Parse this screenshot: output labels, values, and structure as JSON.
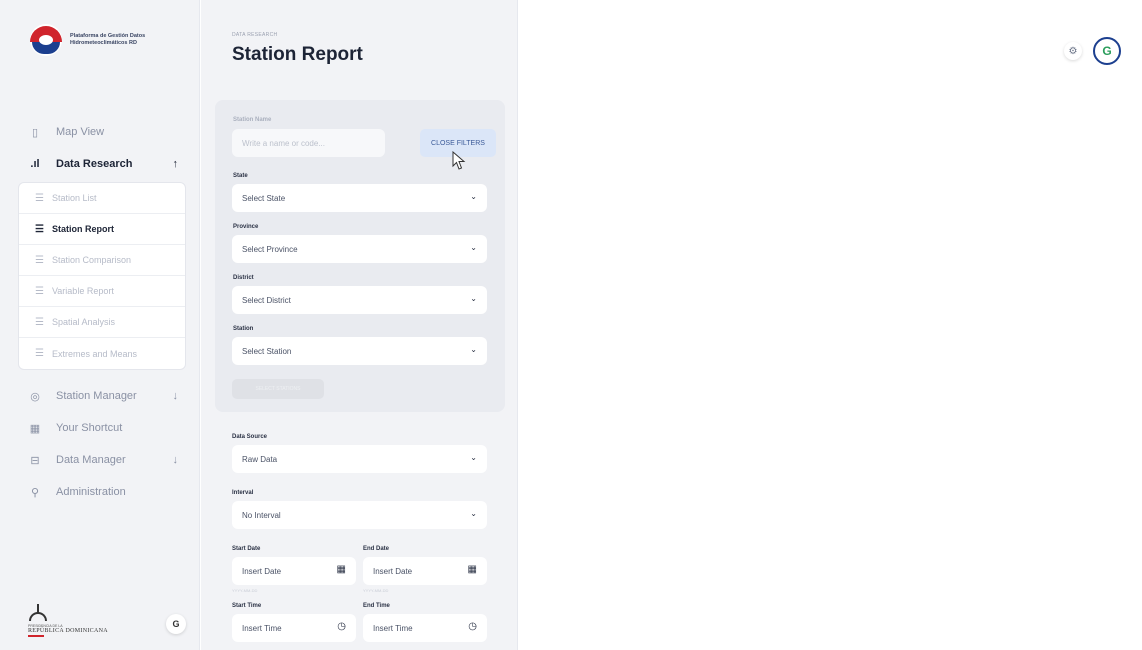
{
  "logo": {
    "line1": "Plataforma de Gestión Datos",
    "line2": "Hidrometeoclimáticos RD"
  },
  "sidebar": {
    "items": [
      {
        "label": "Map View",
        "icon": "map-icon"
      },
      {
        "label": "Data Research",
        "icon": "chart-icon",
        "expanded": true
      },
      {
        "label": "Station Manager",
        "icon": "location-icon"
      },
      {
        "label": "Your Shortcut",
        "icon": "grid-icon"
      },
      {
        "label": "Data Manager",
        "icon": "database-icon"
      },
      {
        "label": "Administration",
        "icon": "wrench-icon"
      }
    ],
    "subitems": [
      {
        "label": "Station List"
      },
      {
        "label": "Station Report",
        "active": true
      },
      {
        "label": "Station Comparison"
      },
      {
        "label": "Variable Report"
      },
      {
        "label": "Spatial Analysis"
      },
      {
        "label": "Extremes and Means"
      }
    ],
    "footer": {
      "line1": "PRESIDENCIA DE LA",
      "line2": "REPÚBLICA DOMINICANA",
      "theme_button": "G"
    }
  },
  "header": {
    "breadcrumb": "DATA RESEARCH",
    "title": "Station Report"
  },
  "filters": {
    "station_name_label": "Station Name",
    "station_name_placeholder": "Write a name or code...",
    "close_filters": "CLOSE FILTERS",
    "state_label": "State",
    "state_value": "Select State",
    "province_label": "Province",
    "province_value": "Select Province",
    "district_label": "District",
    "district_value": "Select District",
    "station_label": "Station",
    "station_value": "Select Station",
    "apply_button": "SELECT STATIONS"
  },
  "form": {
    "data_source_label": "Data Source",
    "data_source_value": "Raw Data",
    "interval_label": "Interval",
    "interval_value": "No Interval",
    "start_date_label": "Start Date",
    "start_date_value": "Insert Date",
    "end_date_label": "End Date",
    "end_date_value": "Insert Date",
    "date_hint": "YYYY-MM-DD",
    "start_time_label": "Start Time",
    "start_time_value": "Insert Time",
    "end_time_label": "End Time",
    "end_time_value": "Insert Time"
  },
  "topbar": {
    "avatar_letter": "G"
  }
}
